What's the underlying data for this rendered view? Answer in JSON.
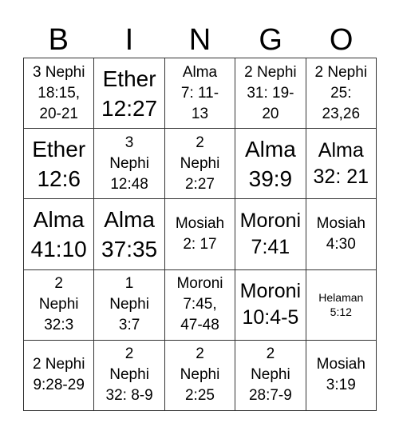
{
  "header": [
    "B",
    "I",
    "N",
    "G",
    "O"
  ],
  "cells": [
    {
      "text": "3 Nephi\n18:15,\n20-21",
      "size": "md"
    },
    {
      "text": "Ether\n12:27",
      "size": "xl"
    },
    {
      "text": "Alma\n7: 11-\n13",
      "size": "md"
    },
    {
      "text": "2 Nephi\n31: 19-\n20",
      "size": "md"
    },
    {
      "text": "2 Nephi\n25:\n23,26",
      "size": "md"
    },
    {
      "text": "Ether\n12:6",
      "size": "xl"
    },
    {
      "text": "3\nNephi\n12:48",
      "size": "md"
    },
    {
      "text": "2\nNephi\n2:27",
      "size": "md"
    },
    {
      "text": "Alma\n39:9",
      "size": "xl"
    },
    {
      "text": "Alma\n32: 21",
      "size": "lg"
    },
    {
      "text": "Alma\n41:10",
      "size": "xl"
    },
    {
      "text": "Alma\n37:35",
      "size": "xl"
    },
    {
      "text": "Mosiah\n2: 17",
      "size": "md"
    },
    {
      "text": "Moroni\n7:41",
      "size": "lg"
    },
    {
      "text": "Mosiah\n4:30",
      "size": "md"
    },
    {
      "text": "2\nNephi\n32:3",
      "size": "md"
    },
    {
      "text": "1\nNephi\n3:7",
      "size": "md"
    },
    {
      "text": "Moroni\n7:45,\n47-48",
      "size": "md"
    },
    {
      "text": "Moroni\n10:4-5",
      "size": "lg"
    },
    {
      "text": "Helaman\n5:12",
      "size": "sm"
    },
    {
      "text": "2 Nephi\n9:28-29",
      "size": "md"
    },
    {
      "text": "2\nNephi\n32: 8-9",
      "size": "md"
    },
    {
      "text": "2\nNephi\n2:25",
      "size": "md"
    },
    {
      "text": "2\nNephi\n28:7-9",
      "size": "md"
    },
    {
      "text": "Mosiah\n3:19",
      "size": "md"
    }
  ]
}
